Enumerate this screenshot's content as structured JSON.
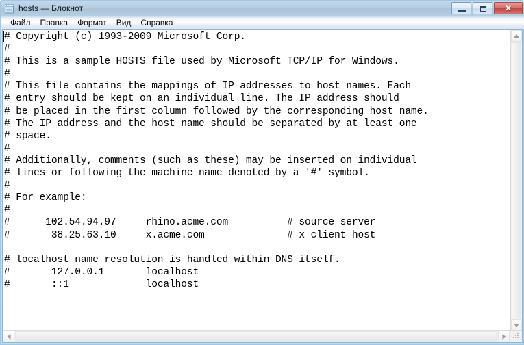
{
  "window": {
    "title": "hosts — Блокнот",
    "icon": "notepad-icon"
  },
  "titlebar_buttons": {
    "minimize_label": "",
    "maximize_label": "",
    "close_label": "✕"
  },
  "menubar": {
    "items": [
      {
        "label": "Файл"
      },
      {
        "label": "Правка"
      },
      {
        "label": "Формат"
      },
      {
        "label": "Вид"
      },
      {
        "label": "Справка"
      }
    ]
  },
  "editor": {
    "content": "# Copyright (c) 1993-2009 Microsoft Corp.\n#\n# This is a sample HOSTS file used by Microsoft TCP/IP for Windows.\n#\n# This file contains the mappings of IP addresses to host names. Each\n# entry should be kept on an individual line. The IP address should\n# be placed in the first column followed by the corresponding host name.\n# The IP address and the host name should be separated by at least one\n# space.\n#\n# Additionally, comments (such as these) may be inserted on individual\n# lines or following the machine name denoted by a '#' symbol.\n#\n# For example:\n#\n#      102.54.94.97     rhino.acme.com          # source server\n#       38.25.63.10     x.acme.com              # x client host\n\n# localhost name resolution is handled within DNS itself.\n#\t127.0.0.1       localhost\n#\t::1             localhost"
  },
  "scrollbars": {
    "vertical": {
      "up_icon": "chevron-up-icon",
      "down_icon": "chevron-down-icon"
    },
    "horizontal": {
      "left_icon": "chevron-left-icon",
      "right_icon": "chevron-right-icon"
    }
  },
  "colors": {
    "titlebar": "#b5cde2",
    "close_button": "#bf4840",
    "text": "#000000",
    "editor_background": "#ffffff",
    "window_frame": "#bcdcf2"
  }
}
